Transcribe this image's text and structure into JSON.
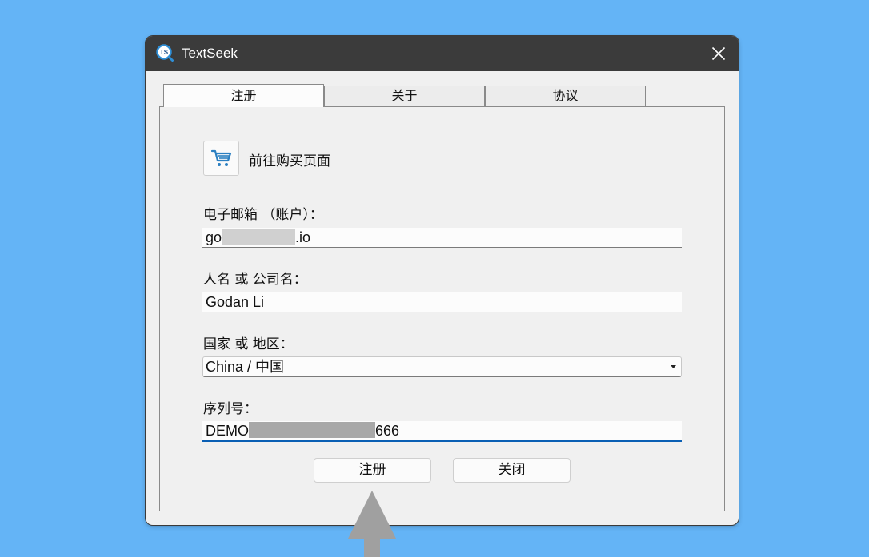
{
  "window": {
    "title": "TextSeek",
    "icon": "ts-logo-icon"
  },
  "tabs": [
    {
      "label": "注册",
      "active": true
    },
    {
      "label": "关于",
      "active": false
    },
    {
      "label": "协议",
      "active": false
    }
  ],
  "purchase": {
    "label": "前往购买页面",
    "icon": "shopping-cart-icon"
  },
  "form": {
    "email": {
      "label": "电子邮箱 （账户）：",
      "value_prefix": "go",
      "value_suffix": ".io"
    },
    "name": {
      "label": "人名 或 公司名：",
      "value": "Godan Li"
    },
    "country": {
      "label": "国家 或 地区：",
      "value": "China / 中国"
    },
    "serial": {
      "label": "序列号：",
      "value_prefix": "DEMO",
      "value_suffix": "666"
    }
  },
  "buttons": {
    "register": "注册",
    "close": "关闭"
  },
  "colors": {
    "background": "#64b4f6",
    "titlebar": "#3b3b3b",
    "focus": "#0a5fb4",
    "cart": "#2b7fc1"
  }
}
